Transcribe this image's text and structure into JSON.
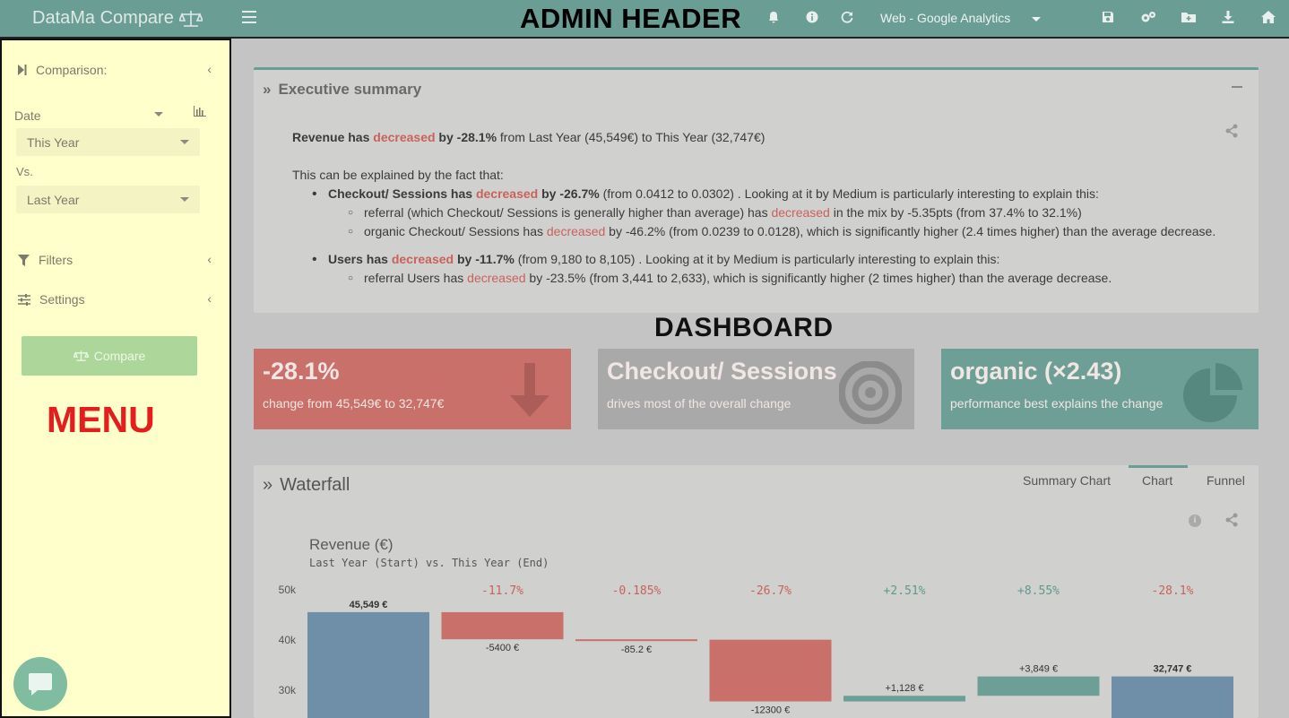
{
  "header": {
    "app_title": "DataMa Compare",
    "overlay_label": "ADMIN HEADER",
    "account": "Web - Google Analytics",
    "icons": [
      "menu-icon",
      "bell-icon",
      "info-icon",
      "refresh-icon",
      "save-icon",
      "settings-icon",
      "folder-icon",
      "download-icon",
      "home-icon"
    ]
  },
  "sidebar": {
    "comparison_label": "Comparison:",
    "date_label": "Date",
    "select_a": "This Year",
    "vs_label": "Vs.",
    "select_b": "Last Year",
    "filters_label": "Filters",
    "settings_label": "Settings",
    "compare_button": "Compare",
    "overlay_label": "MENU"
  },
  "exec_summary": {
    "title": "Executive summary",
    "line1_a": "Revenue has ",
    "line1_red": "decreased",
    "line1_b": " by -28.1%",
    "line1_c": " from Last Year (45,549€) to This Year (32,747€)",
    "intro": "This can be explained by the fact that:",
    "b1_a": "Checkout/ Sessions has ",
    "b1_red": "decreased",
    "b1_b": " by -26.7%",
    "b1_c": " (from 0.0412 to 0.0302) . Looking at it by Medium is particularly interesting to explain this:",
    "b1s1_a": "referral (which Checkout/ Sessions is generally higher than average) has ",
    "b1s1_red": "decreased",
    "b1s1_b": " in the mix by -5.35pts (from 37.4% to 32.1%)",
    "b1s2_a": "organic Checkout/ Sessions has ",
    "b1s2_red": "decreased",
    "b1s2_b": " by -46.2% (from 0.0239 to 0.0128), which is significantly higher (2.4 times higher) than the average decrease.",
    "b2_a": "Users has ",
    "b2_red": "decreased",
    "b2_b": " by -11.7%",
    "b2_c": " (from 9,180 to 8,105) . Looking at it by Medium is particularly interesting to explain this:",
    "b2s1_a": "referral Users has ",
    "b2s1_red": "decreased",
    "b2s1_b": " by -23.5% (from 3,441 to 2,633), which is significantly higher (2 times higher) than the average decrease."
  },
  "dashboard": {
    "overlay_label": "DASHBOARD",
    "tiles": [
      {
        "big": "-28.1%",
        "small": "change from 45,549€ to 32,747€",
        "color": "#c9706b"
      },
      {
        "big": "Checkout/ Sessions",
        "small": "drives most of the overall change",
        "color": "#a9a9a9"
      },
      {
        "big": "organic (×2.43)",
        "small": "performance best explains the change",
        "color": "#6e9f96"
      }
    ]
  },
  "waterfall": {
    "title": "Waterfall",
    "tabs": [
      "Summary Chart",
      "Chart",
      "Funnel"
    ],
    "active_tab": "Chart",
    "chart_title": "Revenue (€)",
    "chart_subtitle": "Last Year (Start) vs. This Year (End)"
  },
  "chart_data": {
    "type": "waterfall",
    "title": "Revenue (€)",
    "subtitle": "Last Year (Start) vs. This Year (End)",
    "y_ticks": [
      "50k",
      "40k",
      "30k"
    ],
    "ylim": [
      30000,
      50000
    ],
    "bars": [
      {
        "kind": "total",
        "start": 0,
        "end": 45549,
        "label": "45,549 €",
        "pct": ""
      },
      {
        "kind": "delta",
        "start": 45549,
        "end": 40149,
        "label": "-5400 €",
        "pct": "-11.7%"
      },
      {
        "kind": "delta",
        "start": 40149,
        "end": 40064,
        "label": "-85.2 €",
        "pct": "-0.185%"
      },
      {
        "kind": "delta",
        "start": 40064,
        "end": 27764,
        "label": "-12300 €",
        "pct": "-26.7%"
      },
      {
        "kind": "delta",
        "start": 27764,
        "end": 28892,
        "label": "+1,128 €",
        "pct": "+2.51%"
      },
      {
        "kind": "delta",
        "start": 28892,
        "end": 32741,
        "label": "+3,849 €",
        "pct": "+8.55%"
      },
      {
        "kind": "total",
        "start": 0,
        "end": 32747,
        "label": "32,747 €",
        "pct": "-28.1%"
      }
    ],
    "colors": {
      "total": "#6f8ea8",
      "negative": "#c9706b",
      "positive": "#6e9f96"
    }
  }
}
